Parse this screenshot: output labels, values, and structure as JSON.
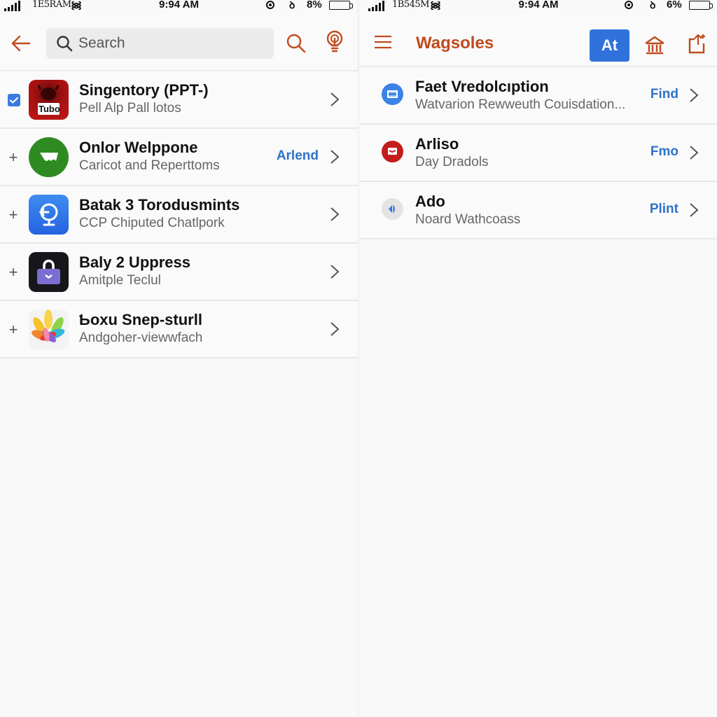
{
  "left_screen": {
    "status": {
      "carrier": "1E5RAM",
      "time": "9:94 AM",
      "battery_pct": "8%"
    },
    "toolbar": {
      "back_icon": "arrow-left-icon",
      "search_placeholder": "Search",
      "search_value": "",
      "search_icon": "search-icon",
      "bulb_icon": "lightbulb-icon"
    },
    "items": [
      {
        "lead": "checkbox-checked",
        "icon": "tubo-app-icon",
        "icon_text": "Tubo",
        "title": "Singentory (PPT-)",
        "subtitle": "Pell Alp Pall lotos",
        "action": ""
      },
      {
        "lead": "+",
        "icon": "chat-bubble-app-icon",
        "title": "Onlor Welppone",
        "subtitle": "Caricot and Reperttoms",
        "action": "Arlend"
      },
      {
        "lead": "+",
        "icon": "globe-app-icon",
        "title": "Batak 3 Torodusmints",
        "subtitle": "CCP Chiputed Chatlpork",
        "action": ""
      },
      {
        "lead": "+",
        "icon": "bag-app-icon",
        "title": "Baly 2 Uppress",
        "subtitle": "Amitple Teclul",
        "action": ""
      },
      {
        "lead": "+",
        "icon": "photos-app-icon",
        "title": "Ƅoxu Snep-sturll",
        "subtitle": "Andgoher-viewwfach",
        "action": ""
      }
    ]
  },
  "right_screen": {
    "status": {
      "carrier": "1B545M",
      "time": "9:94 AM",
      "battery_pct": "6%"
    },
    "toolbar": {
      "menu_icon": "hamburger-menu-icon",
      "title": "Wagsoles",
      "at_button": "At",
      "bank_icon": "bank-icon",
      "share_icon": "share-icon"
    },
    "items": [
      {
        "icon": "blue-circle-app-icon",
        "title": "Faet Vredolcıption",
        "subtitle": "Watvarion Rewweuth Couisdation...",
        "action": "Find"
      },
      {
        "icon": "red-circle-app-icon",
        "title": "Arliso",
        "subtitle": "Day Dradols",
        "action": "Fmo"
      },
      {
        "icon": "gray-circle-app-icon",
        "title": "Ado",
        "subtitle": "Noard Wathcoass",
        "action": "Plint"
      }
    ]
  },
  "colors": {
    "accent_orange": "#c14a1d",
    "accent_blue": "#2f72db",
    "link_blue": "#2f72c8"
  }
}
